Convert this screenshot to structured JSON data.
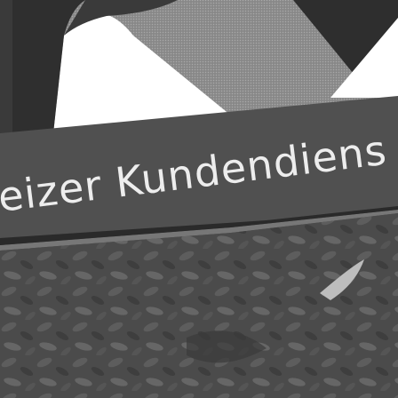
{
  "sign": {
    "text": "eizer Kundendiens"
  },
  "colors": {
    "background_dark": "#3c3c3c",
    "top_panel": "#8a8a8a",
    "sign_board": "#505050",
    "sign_lettering": "#ededed",
    "logo_shape": "#ffffff",
    "foliage": "#5a5a5a"
  }
}
